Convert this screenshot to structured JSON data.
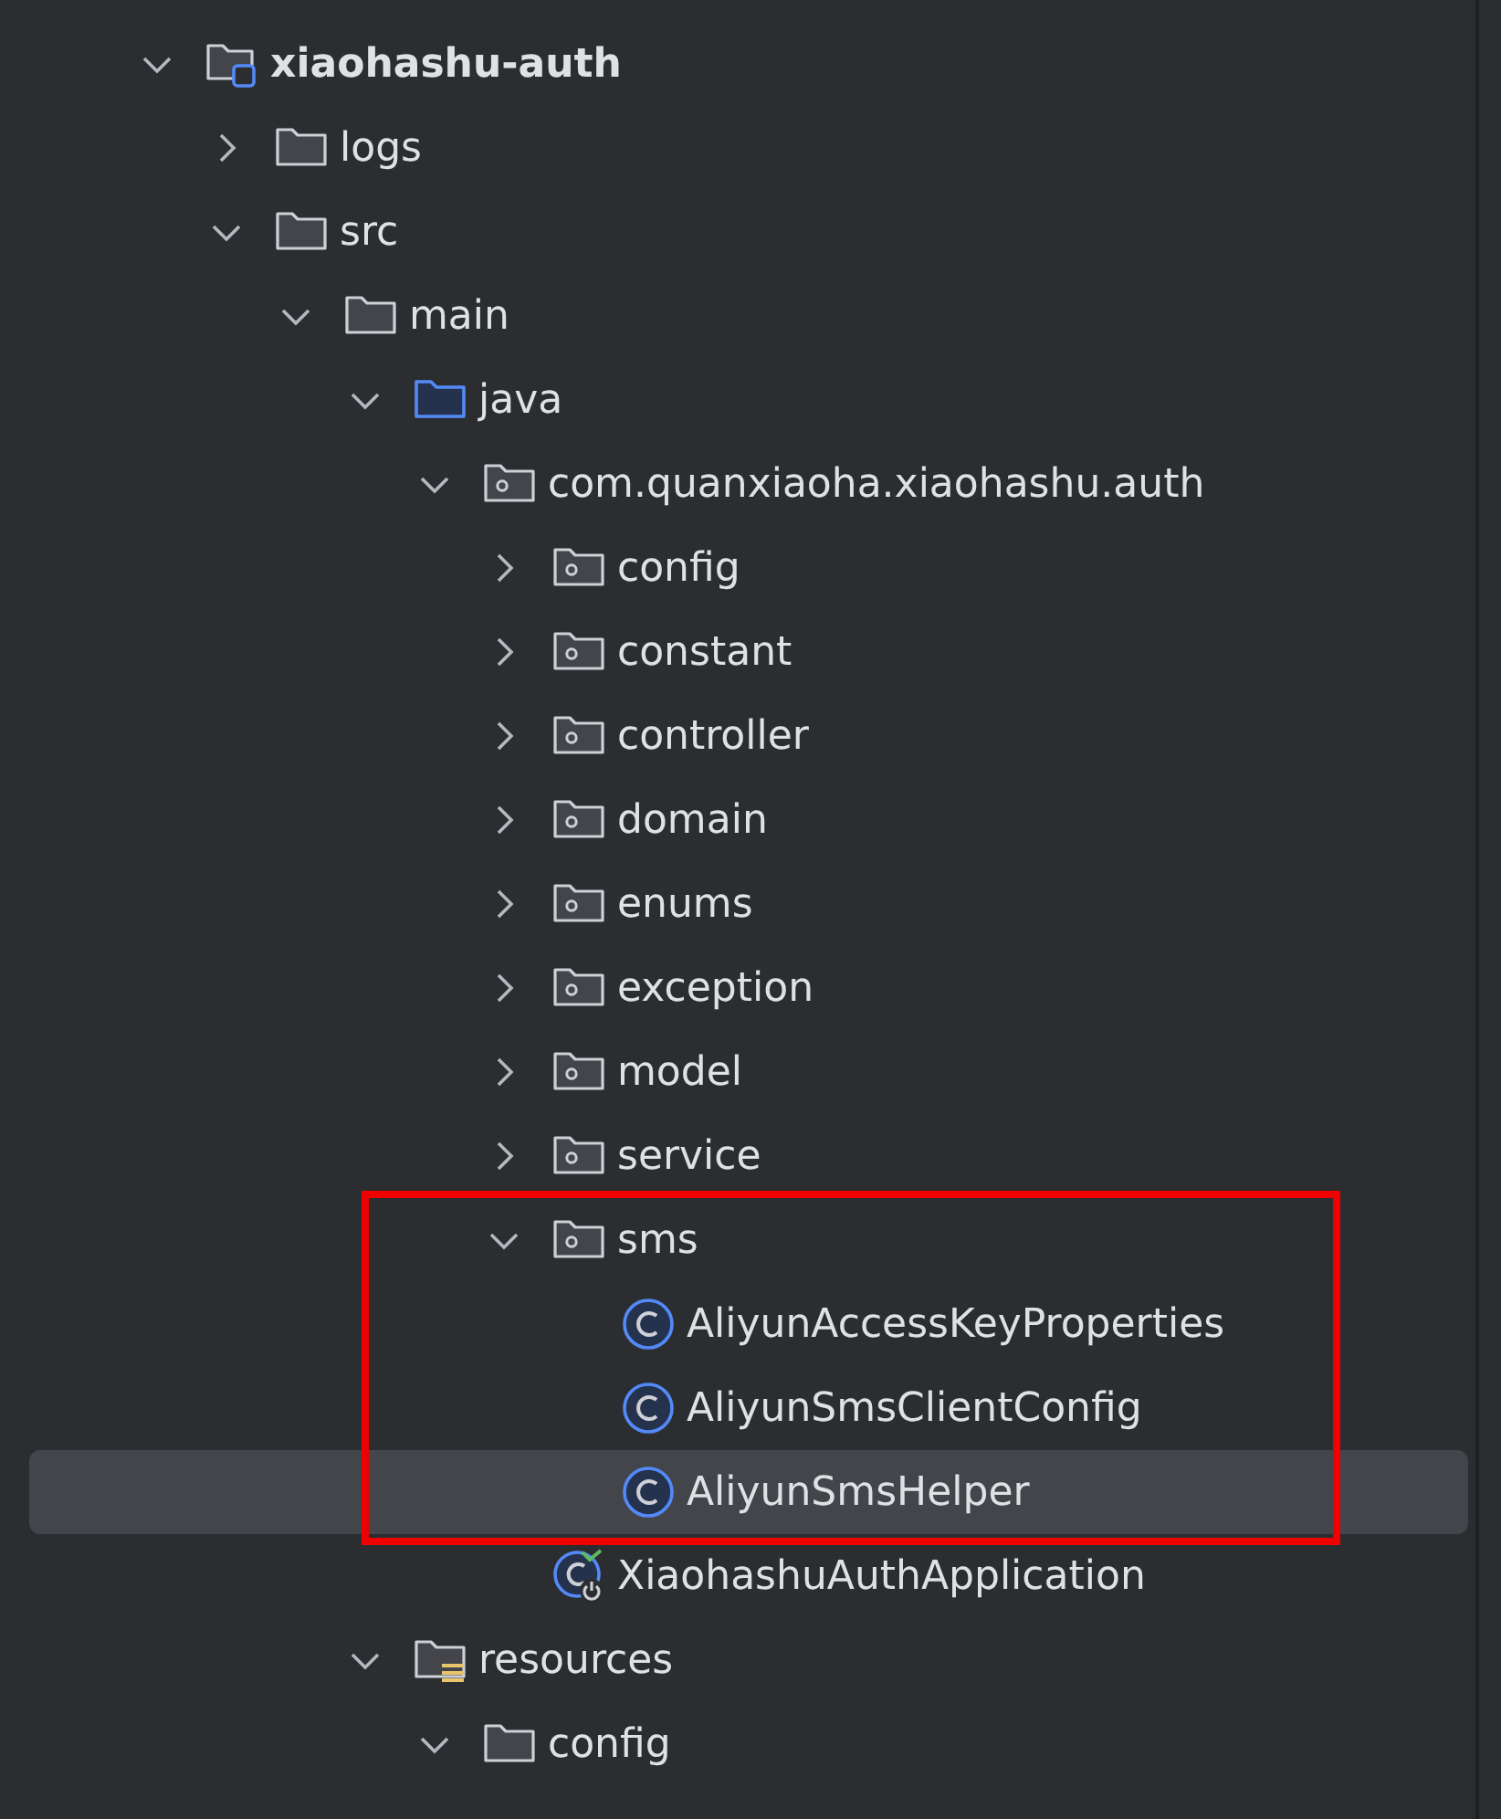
{
  "project_tree": {
    "nodes": [
      {
        "label": "xiaohashu-auth",
        "kind": "module",
        "expanded": true,
        "selected": false,
        "framed": false,
        "children": [
          {
            "label": "logs",
            "kind": "folder",
            "expanded": false,
            "selected": false,
            "framed": false
          },
          {
            "label": "src",
            "kind": "folder",
            "expanded": true,
            "selected": false,
            "framed": false,
            "children": [
              {
                "label": "main",
                "kind": "folder",
                "expanded": true,
                "selected": false,
                "framed": false,
                "children": [
                  {
                    "label": "java",
                    "kind": "source_folder",
                    "expanded": true,
                    "selected": false,
                    "framed": false,
                    "children": [
                      {
                        "label": "com.quanxiaoha.xiaohashu.auth",
                        "kind": "package",
                        "expanded": true,
                        "selected": false,
                        "framed": false,
                        "children": [
                          {
                            "label": "config",
                            "kind": "package",
                            "expanded": false,
                            "selected": false,
                            "framed": false
                          },
                          {
                            "label": "constant",
                            "kind": "package",
                            "expanded": false,
                            "selected": false,
                            "framed": false
                          },
                          {
                            "label": "controller",
                            "kind": "package",
                            "expanded": false,
                            "selected": false,
                            "framed": false
                          },
                          {
                            "label": "domain",
                            "kind": "package",
                            "expanded": false,
                            "selected": false,
                            "framed": false
                          },
                          {
                            "label": "enums",
                            "kind": "package",
                            "expanded": false,
                            "selected": false,
                            "framed": false
                          },
                          {
                            "label": "exception",
                            "kind": "package",
                            "expanded": false,
                            "selected": false,
                            "framed": false
                          },
                          {
                            "label": "model",
                            "kind": "package",
                            "expanded": false,
                            "selected": false,
                            "framed": false
                          },
                          {
                            "label": "service",
                            "kind": "package",
                            "expanded": false,
                            "selected": false,
                            "framed": false
                          },
                          {
                            "label": "sms",
                            "kind": "package",
                            "expanded": true,
                            "selected": false,
                            "framed": true,
                            "children": [
                              {
                                "label": "AliyunAccessKeyProperties",
                                "kind": "class",
                                "selected": false,
                                "framed": true
                              },
                              {
                                "label": "AliyunSmsClientConfig",
                                "kind": "class",
                                "selected": false,
                                "framed": true
                              },
                              {
                                "label": "AliyunSmsHelper",
                                "kind": "class",
                                "selected": true,
                                "framed": true
                              }
                            ]
                          },
                          {
                            "label": "XiaohashuAuthApplication",
                            "kind": "app_class",
                            "selected": false,
                            "framed": false
                          }
                        ]
                      }
                    ]
                  },
                  {
                    "label": "resources",
                    "kind": "resources_folder",
                    "expanded": true,
                    "selected": false,
                    "framed": false,
                    "children": [
                      {
                        "label": "config",
                        "kind": "folder",
                        "expanded": true,
                        "selected": false,
                        "framed": false
                      }
                    ]
                  }
                ]
              }
            ]
          }
        ]
      }
    ]
  }
}
